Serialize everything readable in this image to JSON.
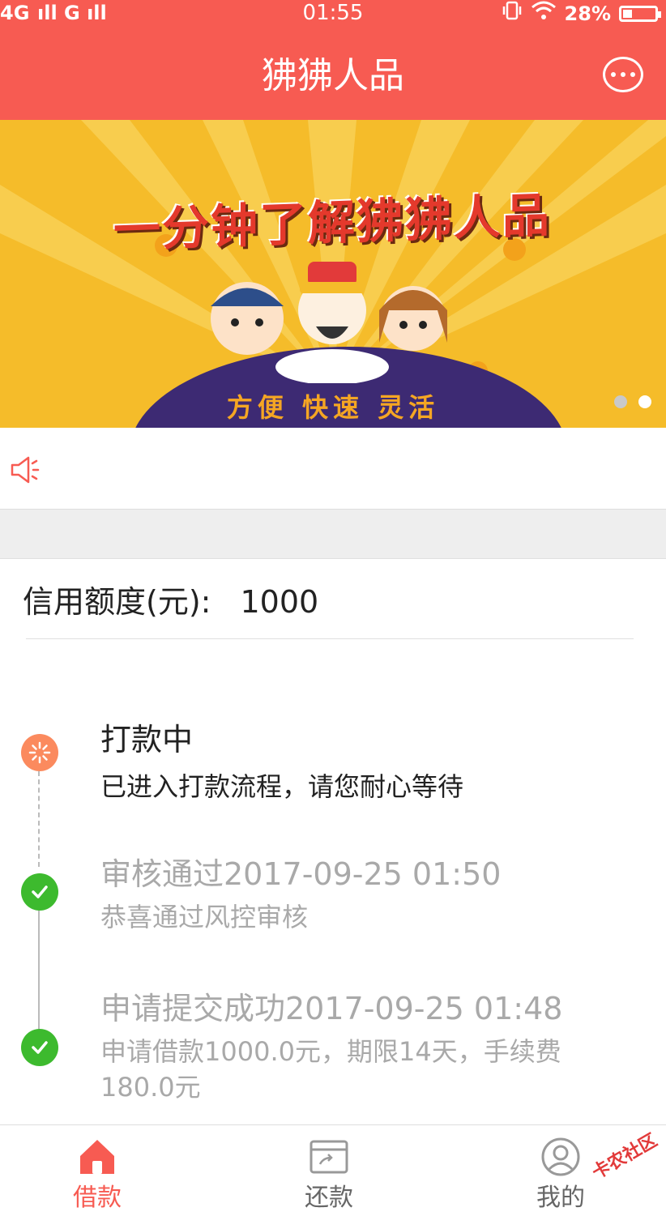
{
  "status_bar": {
    "signal_text": "4G  ıll G ıll",
    "time": "01:55",
    "battery_percent": "28%"
  },
  "nav": {
    "title": "狒狒人品",
    "chat_icon": "chat-bubble-icon"
  },
  "banner": {
    "headline": "一分钟了解狒狒人品",
    "tagline": "方便 快速 灵活",
    "pages": 2,
    "active_page": 2,
    "background_color": "#f5bc2a"
  },
  "notice": {
    "icon": "speaker-icon",
    "text": ""
  },
  "credit": {
    "label": "信用额度(元):",
    "value": "1000"
  },
  "timeline": [
    {
      "title": "打款中",
      "desc": "已进入打款流程，请您耐心等待",
      "state": "active",
      "icon": "clock-icon"
    },
    {
      "title": "审核通过2017-09-25 01:50",
      "desc": "恭喜通过风控审核",
      "state": "done",
      "icon": "check-icon"
    },
    {
      "title": "申请提交成功2017-09-25 01:48",
      "desc": "申请借款1000.0元，期限14天，手续费180.0元",
      "state": "done",
      "icon": "check-icon"
    }
  ],
  "tabs": [
    {
      "label": "借款",
      "icon": "home-icon",
      "active": true
    },
    {
      "label": "还款",
      "icon": "card-icon",
      "active": false
    },
    {
      "label": "我的",
      "icon": "user-icon",
      "active": false
    }
  ],
  "watermark": "卡农社区",
  "colors": {
    "primary": "#f75b52",
    "success": "#3dba2e",
    "pending": "#fb8a5e",
    "muted": "#a9a9a9"
  }
}
